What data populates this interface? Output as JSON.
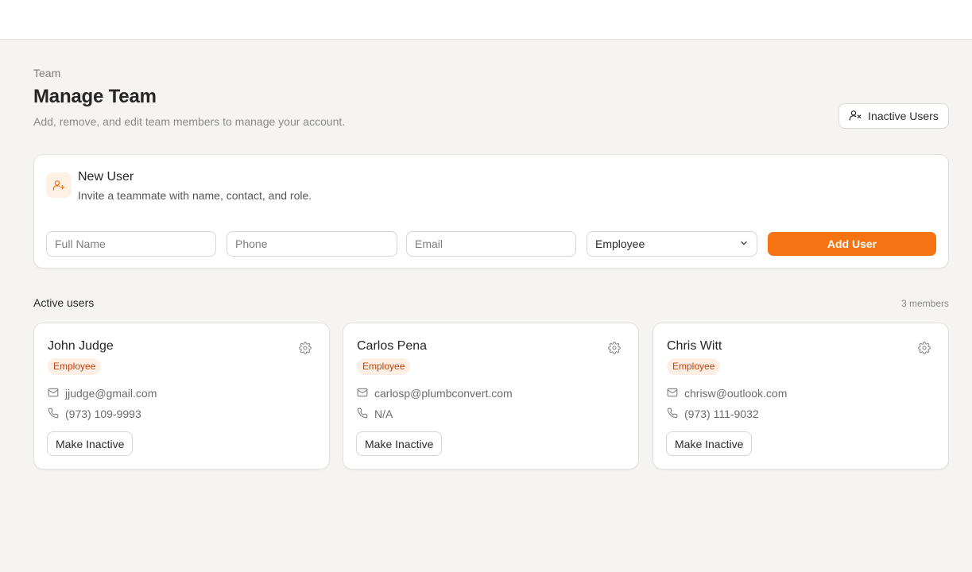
{
  "header": {
    "breadcrumb": "Team",
    "title": "Manage Team",
    "subtitle": "Add, remove, and edit team members to manage your account.",
    "inactive_users_label": "Inactive Users"
  },
  "new_user": {
    "title": "New User",
    "subtitle": "Invite a teammate with name, contact, and role.",
    "full_name_placeholder": "Full Name",
    "phone_placeholder": "Phone",
    "email_placeholder": "Email",
    "role_selected": "Employee",
    "add_button_label": "Add User"
  },
  "active_users": {
    "section_title": "Active users",
    "count_label": "3 members",
    "users": [
      {
        "name": "John Judge",
        "role": "Employee",
        "email": "jjudge@gmail.com",
        "phone": "(973) 109-9993",
        "action_label": "Make Inactive"
      },
      {
        "name": "Carlos Pena",
        "role": "Employee",
        "email": "carlosp@plumbconvert.com",
        "phone": "N/A",
        "action_label": "Make Inactive"
      },
      {
        "name": "Chris Witt",
        "role": "Employee",
        "email": "chrisw@outlook.com",
        "phone": "(973) 111-9032",
        "action_label": "Make Inactive"
      }
    ]
  },
  "colors": {
    "accent": "#f57313",
    "badge_bg": "#fdefe3",
    "badge_text": "#c2410c",
    "background": "#f5f4f2"
  },
  "icons": {
    "inactive_users": "user-x-icon",
    "new_user": "user-plus-icon",
    "select": "chevron-down-icon",
    "settings": "gear-icon",
    "email": "mail-icon",
    "phone": "phone-icon"
  }
}
